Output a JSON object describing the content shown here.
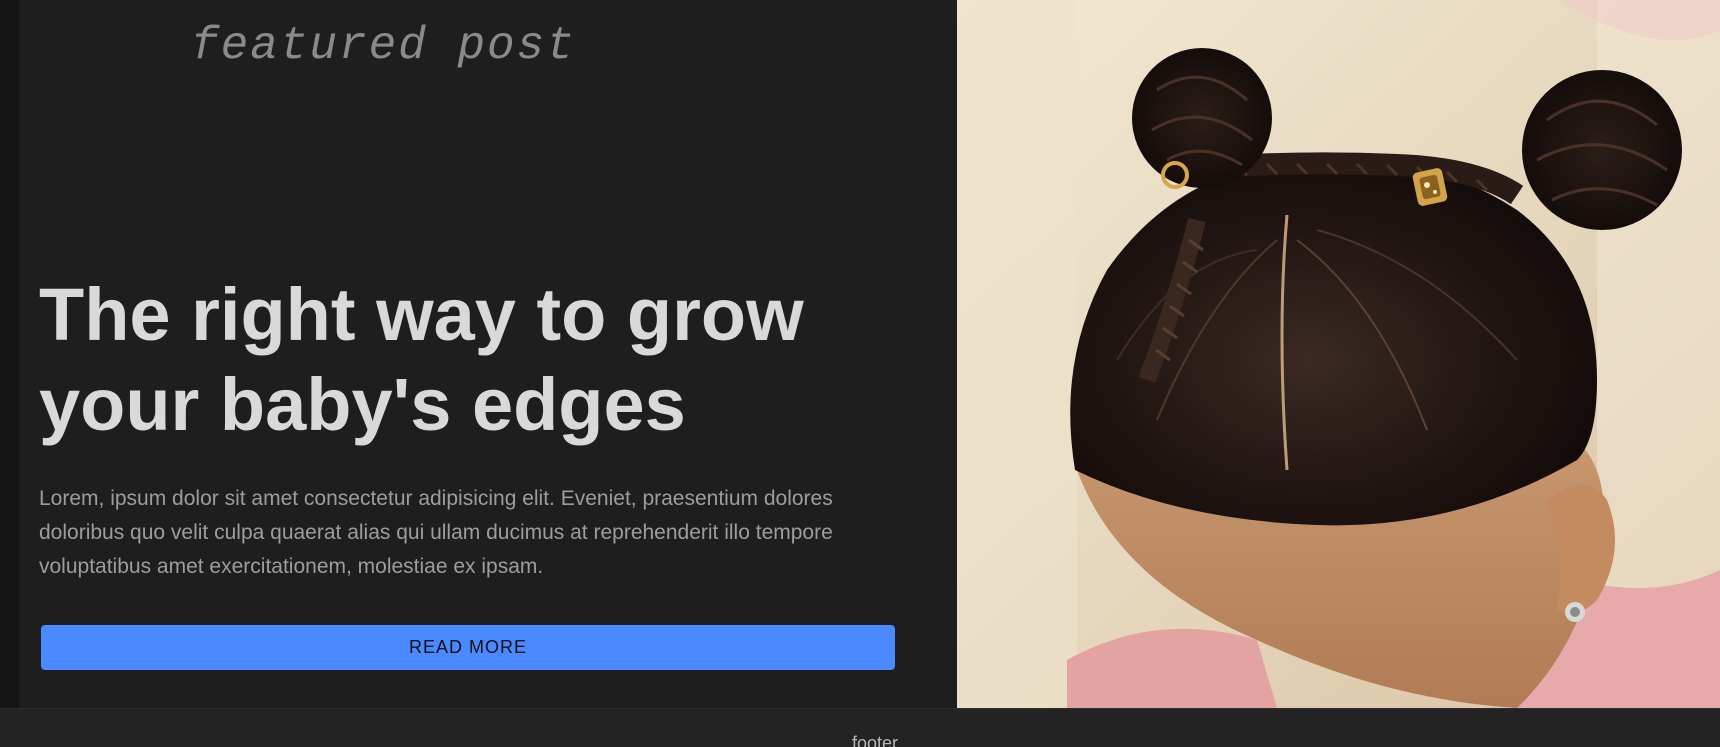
{
  "featured": {
    "eyebrow": "featured post",
    "headline": "The right way to grow your baby's edges",
    "excerpt": "Lorem, ipsum dolor sit amet consectetur adipisicing elit. Eveniet, praesentium dolores doloribus quo velit culpa quaerat alias qui ullam ducimus at reprehenderit illo tempore voluptatibus amet exercitationem, molestiae ex ipsam.",
    "button_label": "READ MORE",
    "image_alt": "Child with two braided hair buns"
  },
  "footer": {
    "label": "footer"
  },
  "colors": {
    "page_background": "#141414",
    "panel_background": "#1e1e1e",
    "accent": "#4a89ff",
    "heading": "#d9d9d9",
    "body_text": "#9d9d9d",
    "eyebrow": "#8a8a8a"
  }
}
